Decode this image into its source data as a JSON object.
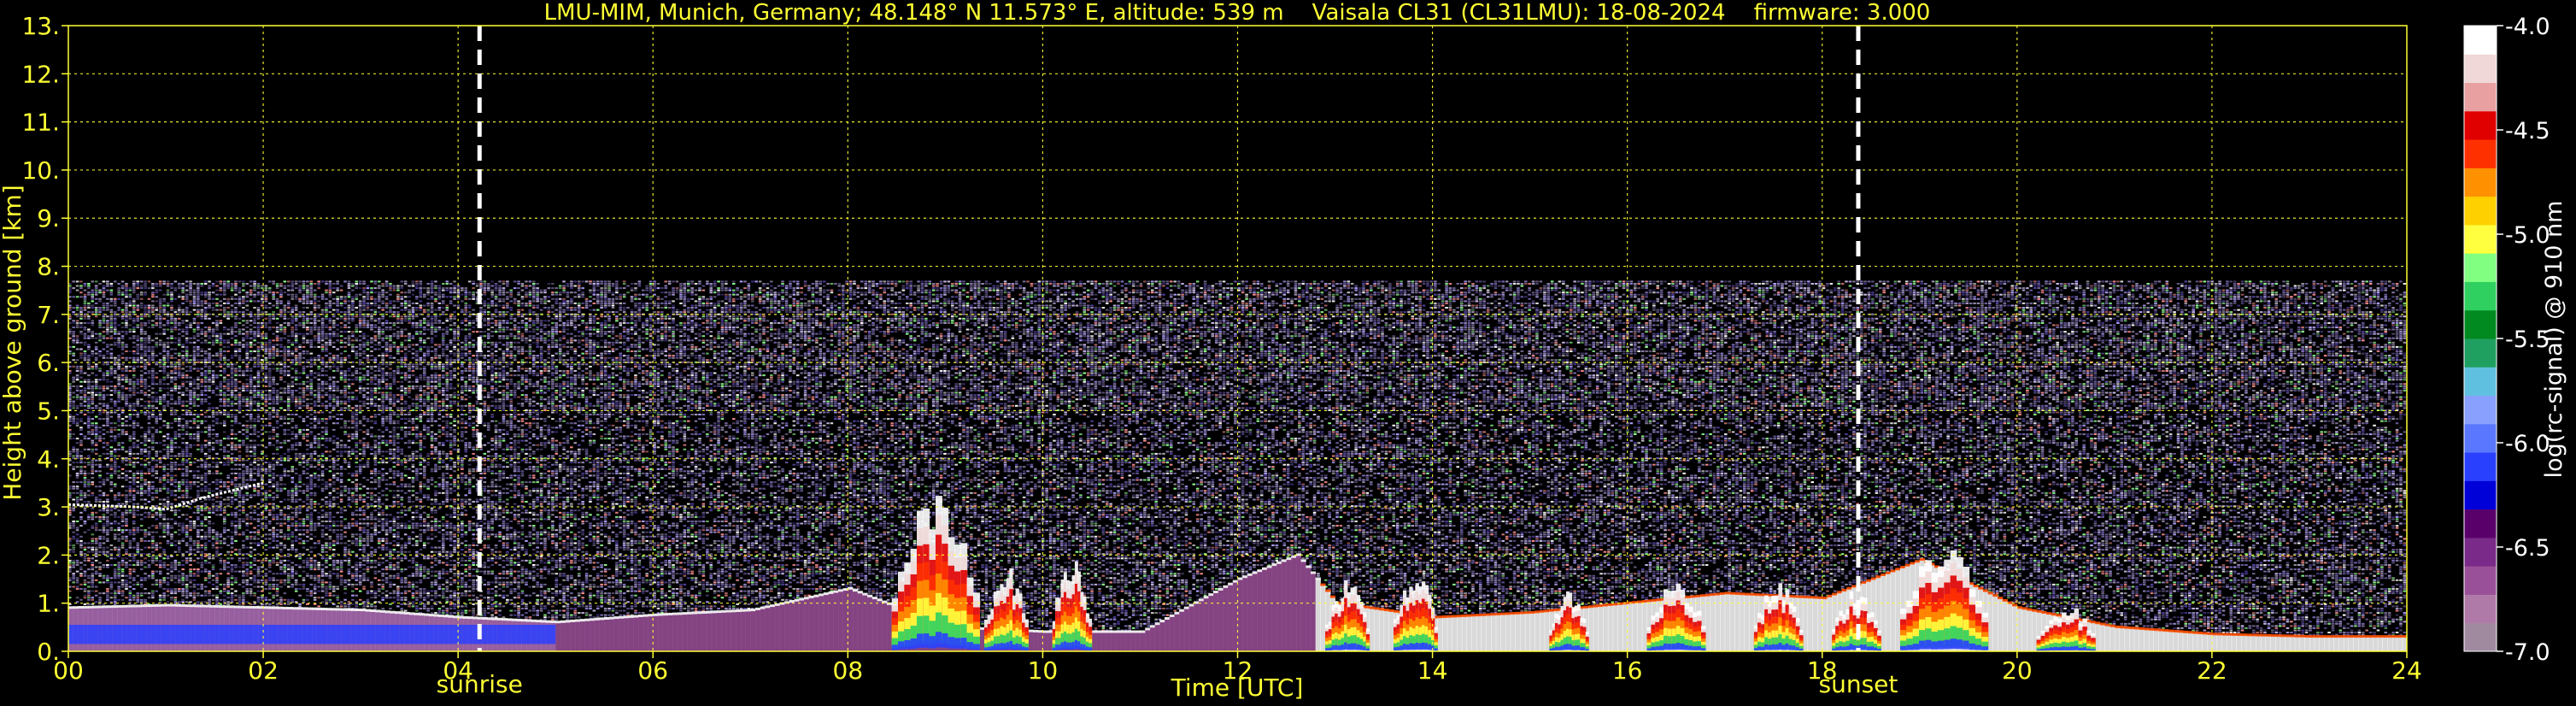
{
  "chart_data": {
    "type": "heatmap",
    "title": "LMU-MIM, Munich, Germany; 48.148° N 11.573° E, altitude: 539 m    Vaisala CL31 (CL31LMU): 18-08-2024    firmware: 3.000",
    "xlabel": "Time [UTC]",
    "ylabel": "Height above ground [km]",
    "xlim": [
      0,
      24
    ],
    "ylim": [
      0,
      13
    ],
    "x_ticks": [
      0,
      2,
      4,
      6,
      8,
      10,
      12,
      14,
      16,
      18,
      20,
      22,
      24
    ],
    "x_tick_labels": [
      "00",
      "02",
      "04",
      "06",
      "08",
      "10",
      "12",
      "14",
      "16",
      "18",
      "20",
      "22",
      "24"
    ],
    "y_ticks": [
      0,
      1,
      2,
      3,
      4,
      5,
      6,
      7,
      8,
      9,
      10,
      11,
      12,
      13
    ],
    "y_tick_labels": [
      "0.",
      "1.",
      "2.",
      "3.",
      "4.",
      "5.",
      "6.",
      "7.",
      "8.",
      "9.",
      "10.",
      "11.",
      "12.",
      "13."
    ],
    "grid": true,
    "colorbar": {
      "label": "log(rc-signal) @ 910 nm",
      "range": [
        -7.0,
        -4.0
      ],
      "ticks": [
        -4.0,
        -4.5,
        -5.0,
        -5.5,
        -6.0,
        -6.5,
        -7.0
      ],
      "tick_labels": [
        "-4.0",
        "-4.5",
        "-5.0",
        "-5.5",
        "-6.0",
        "-6.5",
        "-7.0"
      ],
      "colors": [
        "#a08aa0",
        "#b07aa8",
        "#9a5098",
        "#7a2a88",
        "#5a006a",
        "#0000d8",
        "#2a40ff",
        "#5a78ff",
        "#8aa0ff",
        "#60c0e0",
        "#20a060",
        "#008a20",
        "#30d060",
        "#80ff80",
        "#ffff40",
        "#ffd000",
        "#ff9000",
        "#ff3000",
        "#e00000",
        "#e8a0a0",
        "#f0d8d8",
        "#ffffff"
      ]
    },
    "annotations": [
      {
        "text": "sunrise",
        "x": 4.22
      },
      {
        "text": "sunset",
        "x": 18.37
      }
    ],
    "noise_top_km": 7.7,
    "layers": {
      "residual_layer_top": [
        [
          0,
          3.05
        ],
        [
          0.7,
          3.0
        ],
        [
          1.0,
          2.95
        ],
        [
          1.4,
          3.2
        ],
        [
          1.8,
          3.4
        ],
        [
          2.0,
          3.5
        ]
      ],
      "boundary_layer_top": [
        [
          0,
          0.9
        ],
        [
          1,
          0.95
        ],
        [
          2,
          0.9
        ],
        [
          3,
          0.85
        ],
        [
          4,
          0.7
        ],
        [
          5,
          0.6
        ],
        [
          6,
          0.75
        ],
        [
          7,
          0.85
        ],
        [
          8,
          1.3
        ],
        [
          9,
          0.5
        ],
        [
          10,
          0.4
        ],
        [
          11,
          0.4
        ],
        [
          12,
          1.5
        ],
        [
          12.6,
          2.0
        ],
        [
          13,
          1.0
        ],
        [
          14,
          0.7
        ],
        [
          15,
          0.8
        ],
        [
          16,
          1.0
        ],
        [
          17,
          1.2
        ],
        [
          18,
          1.1
        ],
        [
          19,
          1.9
        ],
        [
          20,
          0.9
        ],
        [
          21,
          0.5
        ],
        [
          22,
          0.35
        ],
        [
          23,
          0.3
        ],
        [
          24,
          0.3
        ]
      ],
      "cloud_plumes": [
        {
          "x0": 8.45,
          "x1": 9.35,
          "top": 3.3
        },
        {
          "x0": 9.4,
          "x1": 9.85,
          "top": 1.8
        },
        {
          "x0": 10.1,
          "x1": 10.5,
          "top": 2.0
        },
        {
          "x0": 12.9,
          "x1": 13.35,
          "top": 1.5
        },
        {
          "x0": 13.6,
          "x1": 14.05,
          "top": 1.7
        },
        {
          "x0": 15.2,
          "x1": 15.6,
          "top": 1.3
        },
        {
          "x0": 16.2,
          "x1": 16.8,
          "top": 1.5
        },
        {
          "x0": 17.3,
          "x1": 17.8,
          "top": 1.45
        },
        {
          "x0": 18.1,
          "x1": 18.6,
          "top": 1.3
        },
        {
          "x0": 18.8,
          "x1": 19.7,
          "top": 2.2
        },
        {
          "x0": 20.2,
          "x1": 20.8,
          "top": 1.0
        }
      ]
    }
  }
}
